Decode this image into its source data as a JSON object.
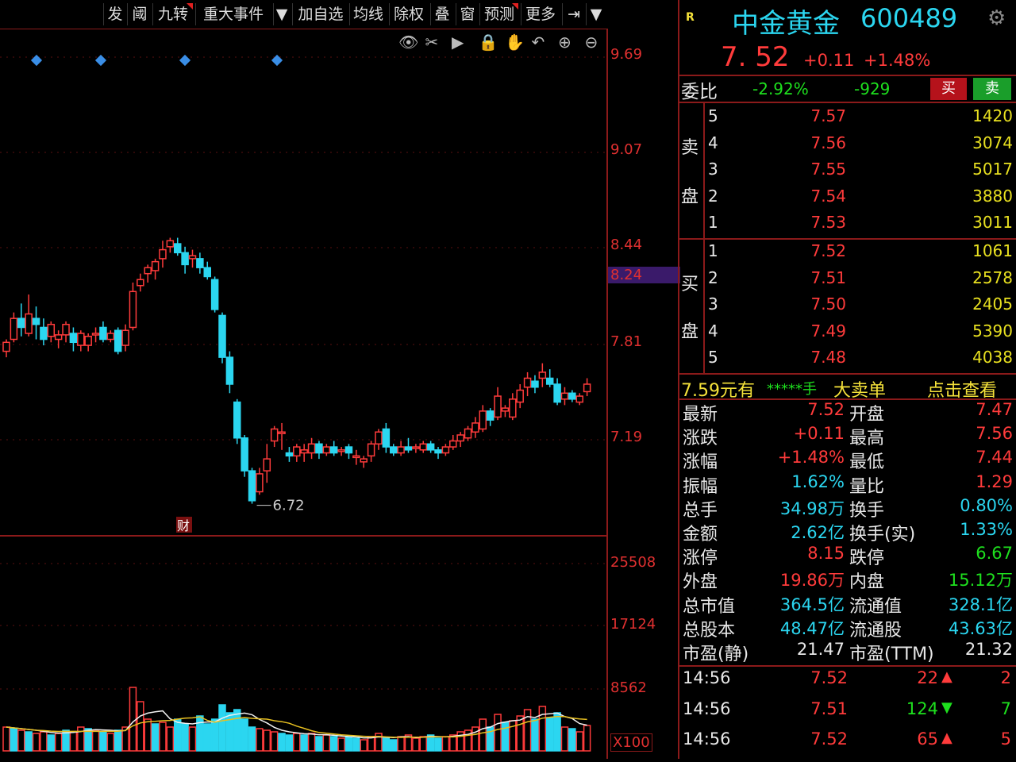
{
  "toolbar": {
    "items": [
      "发",
      "阈",
      "九转",
      "重大事件",
      "▼",
      "加自选",
      "均线",
      "除权",
      "叠",
      "窗",
      "预测",
      "更多",
      "⇥",
      "▼"
    ]
  },
  "chart_tools": [
    "eye-icon",
    "scissors-icon",
    "play-icon",
    "lock-icon",
    "hand-icon",
    "undo-icon",
    "zoom-in-icon",
    "zoom-out-icon"
  ],
  "price_axis": [
    "9.69",
    "9.07",
    "8.44",
    "8.24",
    "7.81",
    "7.19"
  ],
  "volume_axis": [
    "25508",
    "17124",
    "8562",
    "X100"
  ],
  "chart_labels": {
    "low_marker": "6.72",
    "finance_marker": "财"
  },
  "chart_data": {
    "type": "candlestick",
    "y_range": [
      6.5,
      9.9
    ],
    "low_label": 6.72,
    "candles": [
      [
        7.74,
        7.8,
        7.7,
        7.82
      ],
      [
        7.82,
        7.96,
        7.8,
        8.0
      ],
      [
        7.96,
        7.9,
        7.84,
        8.06
      ],
      [
        7.86,
        7.99,
        7.84,
        8.12
      ],
      [
        7.96,
        7.92,
        7.82,
        8.04
      ],
      [
        7.9,
        7.82,
        7.78,
        7.96
      ],
      [
        7.84,
        7.92,
        7.8,
        7.94
      ],
      [
        7.82,
        7.85,
        7.76,
        7.88
      ],
      [
        7.85,
        7.92,
        7.8,
        7.94
      ],
      [
        7.86,
        7.8,
        7.74,
        7.9
      ],
      [
        7.78,
        7.86,
        7.74,
        7.88
      ],
      [
        7.78,
        7.84,
        7.74,
        7.86
      ],
      [
        7.86,
        7.86,
        7.8,
        7.9
      ],
      [
        7.9,
        7.82,
        7.8,
        7.94
      ],
      [
        7.82,
        7.86,
        7.8,
        7.88
      ],
      [
        7.88,
        7.74,
        7.72,
        7.9
      ],
      [
        7.78,
        7.88,
        7.74,
        7.92
      ],
      [
        7.9,
        8.14,
        7.88,
        8.2
      ],
      [
        8.18,
        8.22,
        8.14,
        8.26
      ],
      [
        8.26,
        8.3,
        8.2,
        8.32
      ],
      [
        8.28,
        8.34,
        8.22,
        8.36
      ],
      [
        8.36,
        8.42,
        8.3,
        8.48
      ],
      [
        8.44,
        8.48,
        8.4,
        8.5
      ],
      [
        8.46,
        8.4,
        8.38,
        8.5
      ],
      [
        8.4,
        8.32,
        8.26,
        8.44
      ],
      [
        8.36,
        8.38,
        8.3,
        8.42
      ],
      [
        8.36,
        8.3,
        8.26,
        8.4
      ],
      [
        8.3,
        8.24,
        8.22,
        8.34
      ],
      [
        8.22,
        8.02,
        8.0,
        8.24
      ],
      [
        7.98,
        7.7,
        7.66,
        8.0
      ],
      [
        7.7,
        7.52,
        7.46,
        7.74
      ],
      [
        7.4,
        7.16,
        7.12,
        7.42
      ],
      [
        7.16,
        6.94,
        6.9,
        7.18
      ],
      [
        6.94,
        6.74,
        6.72,
        6.96
      ],
      [
        6.8,
        6.92,
        6.78,
        6.96
      ],
      [
        6.94,
        7.02,
        6.86,
        7.12
      ],
      [
        7.14,
        7.22,
        7.1,
        7.24
      ],
      [
        7.2,
        7.2,
        7.08,
        7.26
      ],
      [
        7.06,
        7.04,
        7.0,
        7.1
      ],
      [
        7.04,
        7.1,
        7.0,
        7.12
      ],
      [
        7.06,
        7.08,
        7.0,
        7.12
      ],
      [
        7.06,
        7.12,
        7.02,
        7.16
      ],
      [
        7.12,
        7.06,
        7.02,
        7.14
      ],
      [
        7.06,
        7.1,
        7.04,
        7.12
      ],
      [
        7.1,
        7.06,
        7.04,
        7.14
      ],
      [
        7.08,
        7.08,
        7.04,
        7.1
      ],
      [
        7.1,
        7.06,
        7.02,
        7.12
      ],
      [
        7.04,
        7.04,
        6.98,
        7.08
      ],
      [
        7.0,
        7.02,
        6.96,
        7.04
      ],
      [
        7.04,
        7.12,
        7.0,
        7.14
      ],
      [
        7.12,
        7.2,
        7.08,
        7.22
      ],
      [
        7.22,
        7.1,
        7.06,
        7.26
      ],
      [
        7.1,
        7.06,
        7.04,
        7.12
      ],
      [
        7.06,
        7.1,
        7.04,
        7.14
      ],
      [
        7.1,
        7.08,
        7.06,
        7.16
      ],
      [
        7.1,
        7.1,
        7.06,
        7.12
      ],
      [
        7.08,
        7.12,
        7.06,
        7.14
      ],
      [
        7.12,
        7.08,
        7.06,
        7.14
      ],
      [
        7.08,
        7.06,
        7.02,
        7.1
      ],
      [
        7.06,
        7.1,
        7.04,
        7.12
      ],
      [
        7.1,
        7.14,
        7.08,
        7.18
      ],
      [
        7.14,
        7.18,
        7.1,
        7.2
      ],
      [
        7.16,
        7.22,
        7.14,
        7.24
      ],
      [
        7.2,
        7.26,
        7.16,
        7.3
      ],
      [
        7.22,
        7.34,
        7.2,
        7.38
      ],
      [
        7.34,
        7.28,
        7.24,
        7.36
      ],
      [
        7.3,
        7.44,
        7.28,
        7.5
      ],
      [
        7.34,
        7.36,
        7.3,
        7.38
      ],
      [
        7.3,
        7.42,
        7.28,
        7.46
      ],
      [
        7.4,
        7.48,
        7.36,
        7.52
      ],
      [
        7.5,
        7.56,
        7.44,
        7.6
      ],
      [
        7.54,
        7.5,
        7.46,
        7.58
      ],
      [
        7.56,
        7.6,
        7.5,
        7.66
      ],
      [
        7.56,
        7.52,
        7.5,
        7.62
      ],
      [
        7.52,
        7.4,
        7.38,
        7.56
      ],
      [
        7.42,
        7.46,
        7.38,
        7.5
      ],
      [
        7.46,
        7.42,
        7.4,
        7.48
      ],
      [
        7.4,
        7.44,
        7.38,
        7.46
      ],
      [
        7.47,
        7.52,
        7.44,
        7.56
      ]
    ],
    "volume": [
      [
        30,
        1
      ],
      [
        28,
        0
      ],
      [
        26,
        1
      ],
      [
        24,
        0
      ],
      [
        22,
        1
      ],
      [
        24,
        1
      ],
      [
        20,
        0
      ],
      [
        22,
        1
      ],
      [
        26,
        0
      ],
      [
        24,
        1
      ],
      [
        30,
        1
      ],
      [
        28,
        0
      ],
      [
        26,
        1
      ],
      [
        24,
        0
      ],
      [
        22,
        1
      ],
      [
        26,
        0
      ],
      [
        30,
        1
      ],
      [
        80,
        1
      ],
      [
        62,
        1
      ],
      [
        40,
        1
      ],
      [
        34,
        0
      ],
      [
        36,
        1
      ],
      [
        30,
        1
      ],
      [
        40,
        0
      ],
      [
        34,
        0
      ],
      [
        30,
        1
      ],
      [
        44,
        0
      ],
      [
        34,
        0
      ],
      [
        40,
        0
      ],
      [
        58,
        0
      ],
      [
        48,
        0
      ],
      [
        52,
        0
      ],
      [
        40,
        0
      ],
      [
        30,
        0
      ],
      [
        28,
        1
      ],
      [
        26,
        1
      ],
      [
        24,
        1
      ],
      [
        22,
        0
      ],
      [
        20,
        0
      ],
      [
        22,
        1
      ],
      [
        20,
        0
      ],
      [
        22,
        1
      ],
      [
        18,
        0
      ],
      [
        20,
        1
      ],
      [
        18,
        0
      ],
      [
        16,
        1
      ],
      [
        18,
        0
      ],
      [
        16,
        0
      ],
      [
        14,
        1
      ],
      [
        18,
        1
      ],
      [
        22,
        1
      ],
      [
        16,
        0
      ],
      [
        14,
        0
      ],
      [
        18,
        1
      ],
      [
        20,
        1
      ],
      [
        16,
        1
      ],
      [
        18,
        1
      ],
      [
        20,
        0
      ],
      [
        16,
        0
      ],
      [
        18,
        1
      ],
      [
        20,
        1
      ],
      [
        24,
        1
      ],
      [
        26,
        1
      ],
      [
        30,
        1
      ],
      [
        40,
        1
      ],
      [
        30,
        0
      ],
      [
        46,
        1
      ],
      [
        36,
        0
      ],
      [
        38,
        1
      ],
      [
        44,
        1
      ],
      [
        52,
        1
      ],
      [
        40,
        0
      ],
      [
        56,
        1
      ],
      [
        42,
        0
      ],
      [
        48,
        0
      ],
      [
        30,
        1
      ],
      [
        28,
        0
      ],
      [
        24,
        1
      ],
      [
        32,
        1
      ]
    ]
  },
  "header": {
    "flag": "R",
    "stock_name": "中金黄金",
    "stock_code": "600489",
    "price": "7. 52",
    "change": "+0.11",
    "change_pct": "+1.48%"
  },
  "weibi": {
    "label": "委比",
    "pct": "-2.92%",
    "diff": "-929",
    "buy_btn": "买",
    "sell_btn": "卖"
  },
  "order_book": {
    "sell_label_top": "卖",
    "sell_label_bottom": "盘",
    "buy_label_top": "买",
    "buy_label_bottom": "盘",
    "sell": [
      {
        "level": "5",
        "price": "7.57",
        "vol": "1420"
      },
      {
        "level": "4",
        "price": "7.56",
        "vol": "3074"
      },
      {
        "level": "3",
        "price": "7.55",
        "vol": "5017"
      },
      {
        "level": "2",
        "price": "7.54",
        "vol": "3880"
      },
      {
        "level": "1",
        "price": "7.53",
        "vol": "3011"
      }
    ],
    "buy": [
      {
        "level": "1",
        "price": "7.52",
        "vol": "1061"
      },
      {
        "level": "2",
        "price": "7.51",
        "vol": "2578"
      },
      {
        "level": "3",
        "price": "7.50",
        "vol": "2405"
      },
      {
        "level": "4",
        "price": "7.49",
        "vol": "5390"
      },
      {
        "level": "5",
        "price": "7.48",
        "vol": "4038"
      }
    ]
  },
  "big_order": {
    "price": "7.59元有",
    "stars": "*****手",
    "type": "大卖单",
    "action": "点击查看"
  },
  "stats": [
    {
      "k1": "最新",
      "v1": "7.52",
      "c1": "red",
      "k2": "开盘",
      "v2": "7.47",
      "c2": "red"
    },
    {
      "k1": "涨跌",
      "v1": "+0.11",
      "c1": "red",
      "k2": "最高",
      "v2": "7.56",
      "c2": "red"
    },
    {
      "k1": "涨幅",
      "v1": "+1.48%",
      "c1": "red",
      "k2": "最低",
      "v2": "7.44",
      "c2": "red"
    },
    {
      "k1": "振幅",
      "v1": "1.62%",
      "c1": "cyan",
      "k2": "量比",
      "v2": "1.29",
      "c2": "red"
    },
    {
      "k1": "总手",
      "v1": "34.98万",
      "c1": "cyan",
      "k2": "换手",
      "v2": "0.80%",
      "c2": "cyan"
    },
    {
      "k1": "金额",
      "v1": "2.62亿",
      "c1": "cyan",
      "k2": "换手(实)",
      "v2": "1.33%",
      "c2": "cyan"
    },
    {
      "k1": "涨停",
      "v1": "8.15",
      "c1": "red",
      "k2": "跌停",
      "v2": "6.67",
      "c2": "green"
    },
    {
      "k1": "外盘",
      "v1": "19.86万",
      "c1": "red",
      "k2": "内盘",
      "v2": "15.12万",
      "c2": "green"
    },
    {
      "k1": "总市值",
      "v1": "364.5亿",
      "c1": "cyan",
      "k2": "流通值",
      "v2": "328.1亿",
      "c2": "cyan"
    },
    {
      "k1": "总股本",
      "v1": "48.47亿",
      "c1": "cyan",
      "k2": "流通股",
      "v2": "43.63亿",
      "c2": "cyan"
    },
    {
      "k1": "市盈(静)",
      "v1": "21.47",
      "c1": "white",
      "k2": "市盈(TTM)",
      "v2": "21.32",
      "c2": "white"
    }
  ],
  "ticks": [
    {
      "time": "14:56",
      "price": "7.52",
      "vol": "22",
      "dir": "up",
      "n": "2"
    },
    {
      "time": "14:56",
      "price": "7.51",
      "vol": "124",
      "dir": "down",
      "n": "7"
    },
    {
      "time": "14:56",
      "price": "7.52",
      "vol": "65",
      "dir": "up",
      "n": "5"
    }
  ],
  "colors": {
    "up": "#ff3b3b",
    "down": "#2bd6f0",
    "grid": "#8b1a1a",
    "diamond": "#3a8ee6"
  }
}
